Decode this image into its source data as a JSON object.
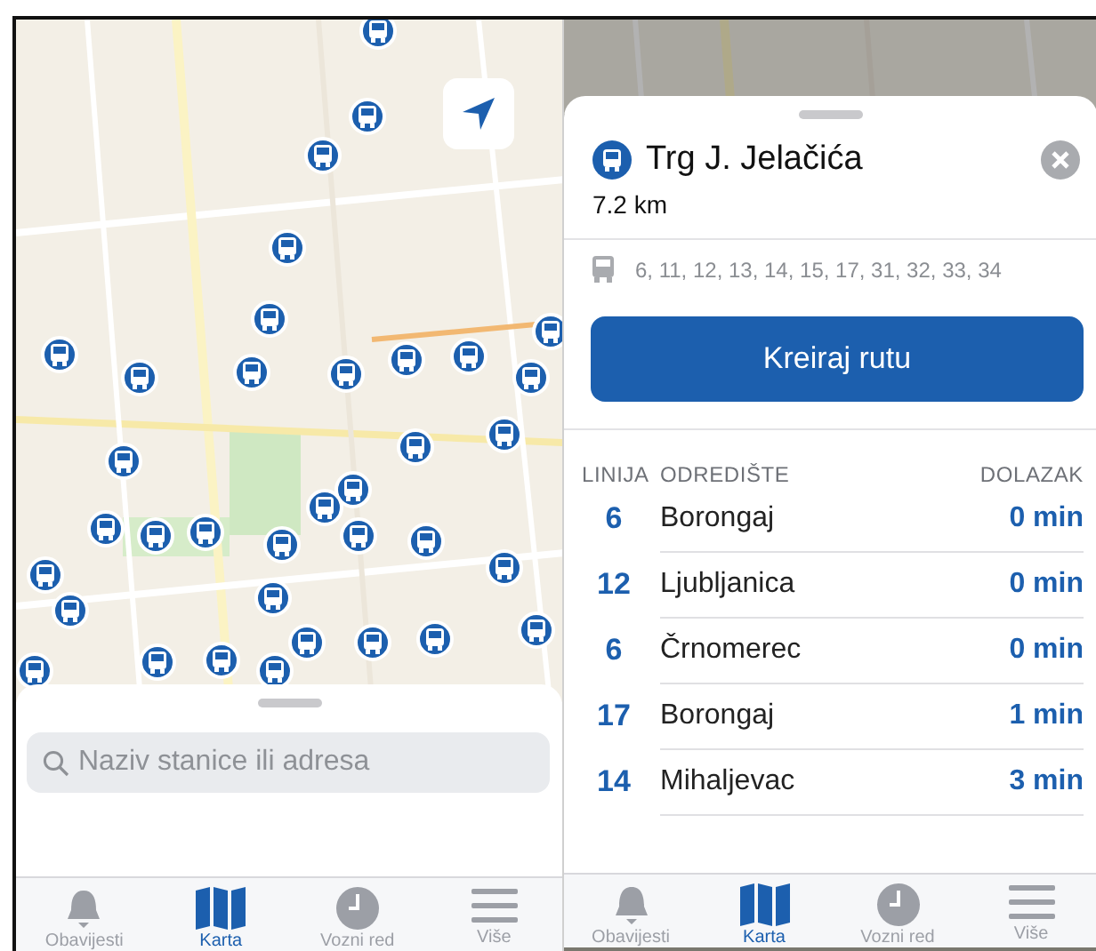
{
  "left_screen": {
    "search": {
      "placeholder": "Naziv stanice ili adresa"
    },
    "tab_bar": [
      {
        "label": "Obavijesti",
        "kind": "bell",
        "selected": false
      },
      {
        "label": "Karta",
        "kind": "map",
        "selected": true
      },
      {
        "label": "Vozni red",
        "kind": "clock",
        "selected": false
      },
      {
        "label": "Više",
        "kind": "menu",
        "selected": false
      }
    ]
  },
  "right_screen": {
    "station": {
      "name": "Trg J. Jelačića",
      "distance": "7.2 km",
      "lines": "6, 11, 12, 13, 14, 15, 17, 31, 32, 33, 34"
    },
    "route_button": "Kreiraj rutu",
    "departures": {
      "columns": [
        "LINIJA",
        "ODREDIŠTE",
        "DOLAZAK"
      ],
      "rows": [
        {
          "line": "6",
          "destination": "Borongaj",
          "arrival": "0 min"
        },
        {
          "line": "12",
          "destination": "Ljubljanica",
          "arrival": "0 min"
        },
        {
          "line": "6",
          "destination": "Črnomerec",
          "arrival": "0 min"
        },
        {
          "line": "17",
          "destination": "Borongaj",
          "arrival": "1 min"
        },
        {
          "line": "14",
          "destination": "Mihaljevac",
          "arrival": "3 min"
        }
      ]
    },
    "tab_bar": [
      {
        "label": "Obavijesti",
        "kind": "bell",
        "selected": false
      },
      {
        "label": "Karta",
        "kind": "map",
        "selected": true
      },
      {
        "label": "Vozni red",
        "kind": "clock",
        "selected": false
      },
      {
        "label": "Više",
        "kind": "menu",
        "selected": false
      }
    ]
  }
}
